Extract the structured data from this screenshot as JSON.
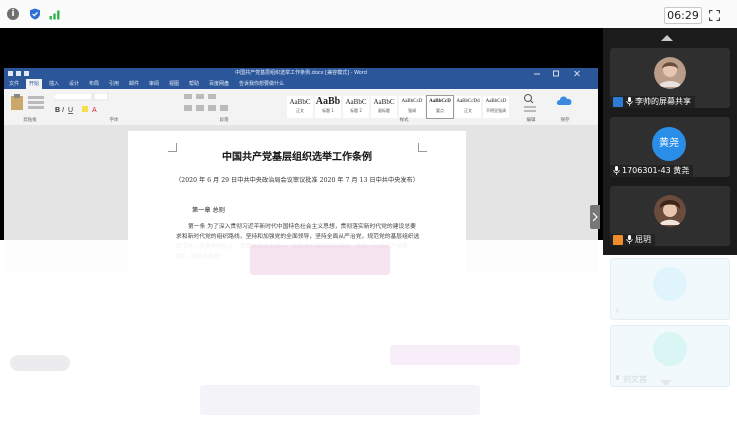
{
  "topbar": {
    "time": "06:29",
    "icons": [
      "info-icon",
      "shield-icon",
      "signal-icon",
      "fullscreen-icon"
    ]
  },
  "word": {
    "window_title": "中国共产党基层组织选举工作条例.docx [兼容模式] - Word",
    "tabs": [
      "文件",
      "开始",
      "插入",
      "设计",
      "布局",
      "引用",
      "邮件",
      "审阅",
      "视图",
      "帮助",
      "百度网盘",
      "告诉我你想要做什么"
    ],
    "active_tab": "开始",
    "styles": [
      {
        "sample": "AaBbC",
        "name": "正文"
      },
      {
        "sample": "AaBb",
        "name": "标题 1"
      },
      {
        "sample": "AaBbC",
        "name": "标题 2"
      },
      {
        "sample": "AaBbC",
        "name": "副标题"
      },
      {
        "sample": "AaBbCcD",
        "name": "强调"
      },
      {
        "sample": "AaBbCcD",
        "name": "要点"
      },
      {
        "sample": "AaBbCcDd",
        "name": "正文"
      },
      {
        "sample": "AaBbCcD",
        "name": "不明显强调"
      }
    ],
    "group_labels": [
      "剪贴板",
      "字体",
      "段落",
      "样式",
      "编辑",
      "保存"
    ],
    "doc": {
      "title": "中国共产党基层组织选举工作条例",
      "subtitle": "（2020 年 6 月 29 日中共中央政治局会议审议批准    2020 年 7 月 13 日中共中央发布）",
      "chapter": "第一章   总则",
      "body": "第一条  为了深入贯彻习近平新时代中国特色社会主义思想，贯彻落实新时代党的建设总要求和新时代党的组织路线，坚持和加强党的全面领导，坚持全面从严治党，规范党的基层组织选举工作，发扬党内民主，保障党员民主权利，加强党的基层组织建设，根据《中国共产党章程》，制定本条例。"
    }
  },
  "participants": [
    {
      "label": "李帅的屏幕共享",
      "avatar": "photo",
      "badge": "screen-share"
    },
    {
      "label": "1706301-43 黄尧",
      "avatar_text": "黄尧",
      "badge": "none"
    },
    {
      "label": "屈玥",
      "avatar": "photo",
      "badge": "host"
    },
    {
      "label": "",
      "avatar": "faded",
      "badge": "none"
    },
    {
      "label": "刘文茜",
      "avatar": "faded",
      "badge": "none"
    }
  ],
  "colors": {
    "word_blue": "#2b579a",
    "avatar_blue": "#2a8ee8",
    "stage_black": "#000000",
    "rail_dark": "#1b1b1b"
  }
}
